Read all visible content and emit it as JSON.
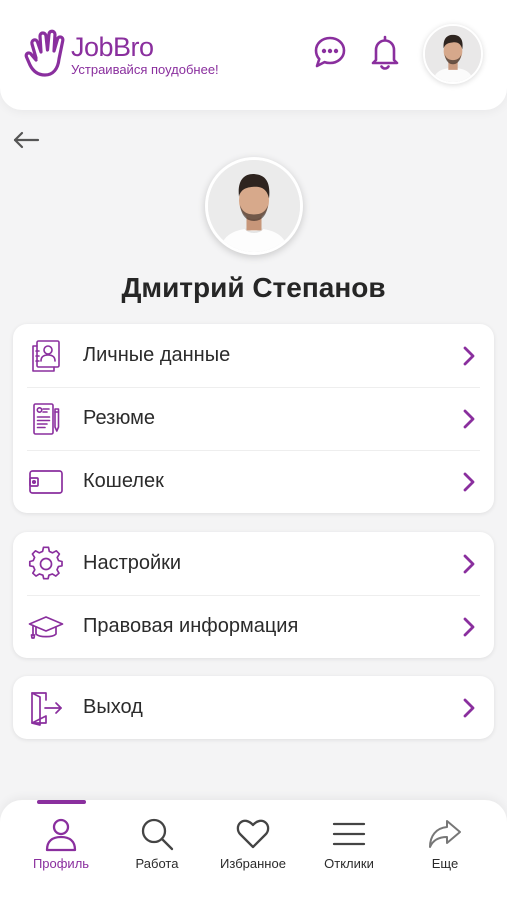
{
  "colors": {
    "accent": "#8a2f9e",
    "background": "#f4f4f5",
    "card": "#ffffff",
    "text": "#2b2b2b"
  },
  "header": {
    "logo_title": "JobBro",
    "logo_tagline": "Устраивайся поудобнее!",
    "logo_icon": "hand-icon",
    "chat_icon": "chat-icon",
    "bell_icon": "bell-icon",
    "avatar_icon": "user-avatar"
  },
  "profile": {
    "back_icon": "arrow-left-icon",
    "name": "Дмитрий Степанов"
  },
  "menu_groups": [
    {
      "items": [
        {
          "label": "Личные данные",
          "icon": "personal-data-icon"
        },
        {
          "label": "Резюме",
          "icon": "resume-icon"
        },
        {
          "label": "Кошелек",
          "icon": "wallet-icon"
        }
      ]
    },
    {
      "items": [
        {
          "label": "Настройки",
          "icon": "gear-icon"
        },
        {
          "label": "Правовая информация",
          "icon": "graduation-cap-icon"
        }
      ]
    },
    {
      "items": [
        {
          "label": "Выход",
          "icon": "logout-icon"
        }
      ]
    }
  ],
  "tabbar": {
    "active_index": 0,
    "tabs": [
      {
        "label": "Профиль",
        "icon": "user-icon"
      },
      {
        "label": "Работа",
        "icon": "search-icon"
      },
      {
        "label": "Избранное",
        "icon": "heart-icon"
      },
      {
        "label": "Отклики",
        "icon": "menu-icon"
      },
      {
        "label": "Еще",
        "icon": "share-icon"
      }
    ]
  }
}
